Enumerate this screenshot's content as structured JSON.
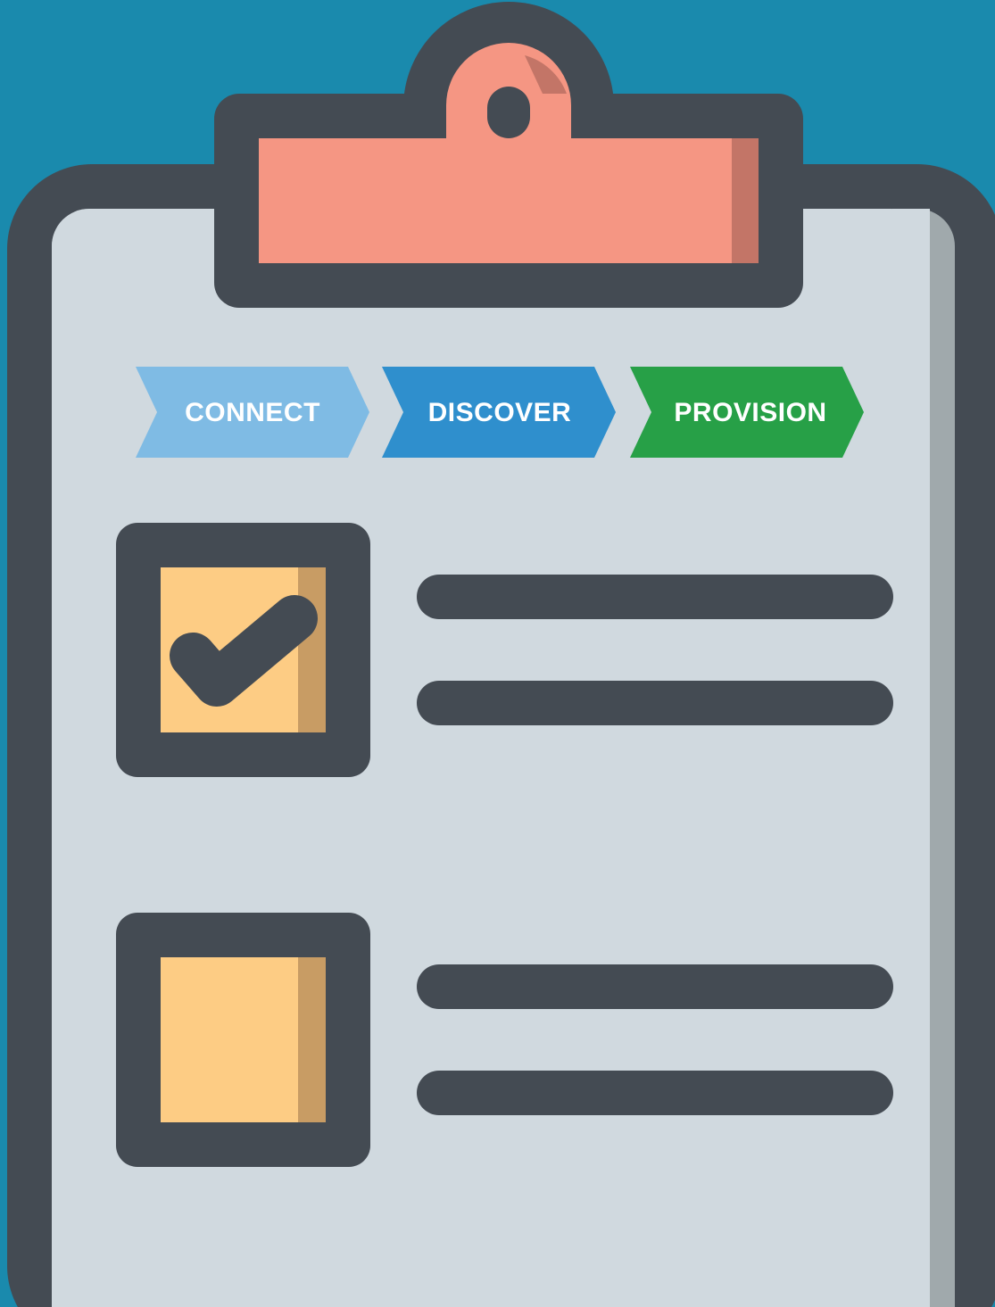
{
  "steps": [
    {
      "label": "CONNECT",
      "color": "#7fbbe4"
    },
    {
      "label": "DISCOVER",
      "color": "#2f8fcd"
    },
    {
      "label": "PROVISION",
      "color": "#27a047"
    }
  ],
  "checklist": [
    {
      "checked": true
    },
    {
      "checked": false
    }
  ],
  "colors": {
    "background": "#1a8aad",
    "outline": "#444b53",
    "paper": "#d0d9df",
    "paper_shadow": "#a0a9ac",
    "clip": "#f59683",
    "clip_shadow": "#c37567",
    "checkbox_fill": "#fdcc84",
    "checkbox_shadow": "#c89c64"
  },
  "icons": {
    "check": "check-icon"
  }
}
